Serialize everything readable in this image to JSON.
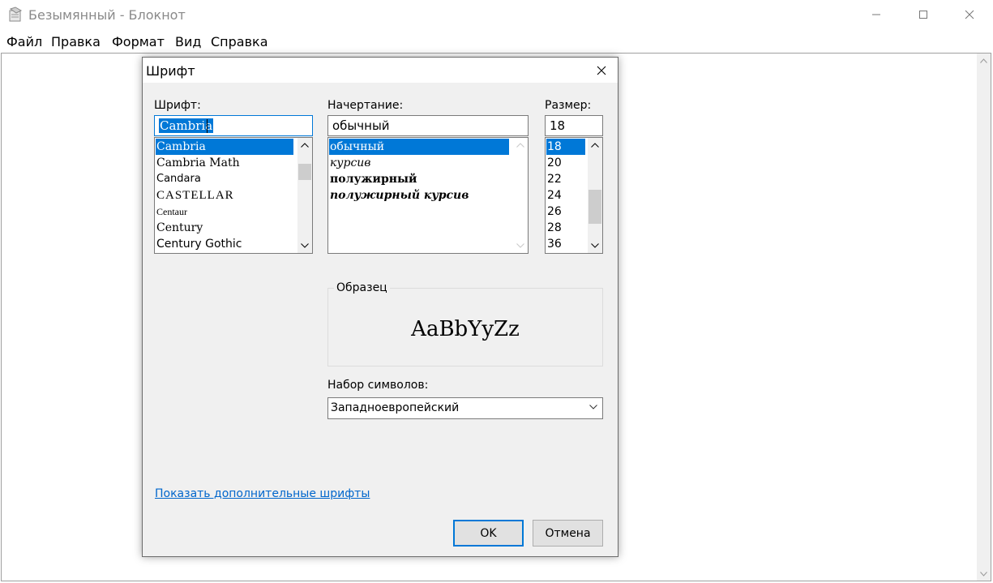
{
  "window": {
    "title": "Безымянный - Блокнот",
    "app_icon": "notepad-icon",
    "controls": [
      "minimize-icon",
      "maximize-icon",
      "close-icon"
    ]
  },
  "menu": {
    "items": [
      "Файл",
      "Правка",
      "Формат",
      "Вид",
      "Справка"
    ]
  },
  "dialog": {
    "title": "Шрифт",
    "font": {
      "label": "Шрифт:",
      "value": "Cambria",
      "items": [
        "Cambria",
        "Cambria Math",
        "Candara",
        "CASTELLAR",
        "Centaur",
        "Century",
        "Century Gothic"
      ],
      "selected": "Cambria"
    },
    "style": {
      "label": "Начертание:",
      "value": "обычный",
      "items": [
        "обычный",
        "курсив",
        "полужирный",
        "полужирный курсив"
      ],
      "selected": "обычный"
    },
    "size": {
      "label": "Размер:",
      "value": "18",
      "items": [
        "18",
        "20",
        "22",
        "24",
        "26",
        "28",
        "36"
      ],
      "selected": "18"
    },
    "sample": {
      "label": "Образец",
      "text": "AaBbYyZz"
    },
    "charset": {
      "label": "Набор символов:",
      "value": "Западноевропейский"
    },
    "more_fonts_link": "Показать дополнительные шрифты",
    "ok_label": "OK",
    "cancel_label": "Отмена"
  },
  "colors": {
    "accent": "#0078d7",
    "dialog_bg": "#f0f0f0",
    "link": "#0066cc"
  }
}
